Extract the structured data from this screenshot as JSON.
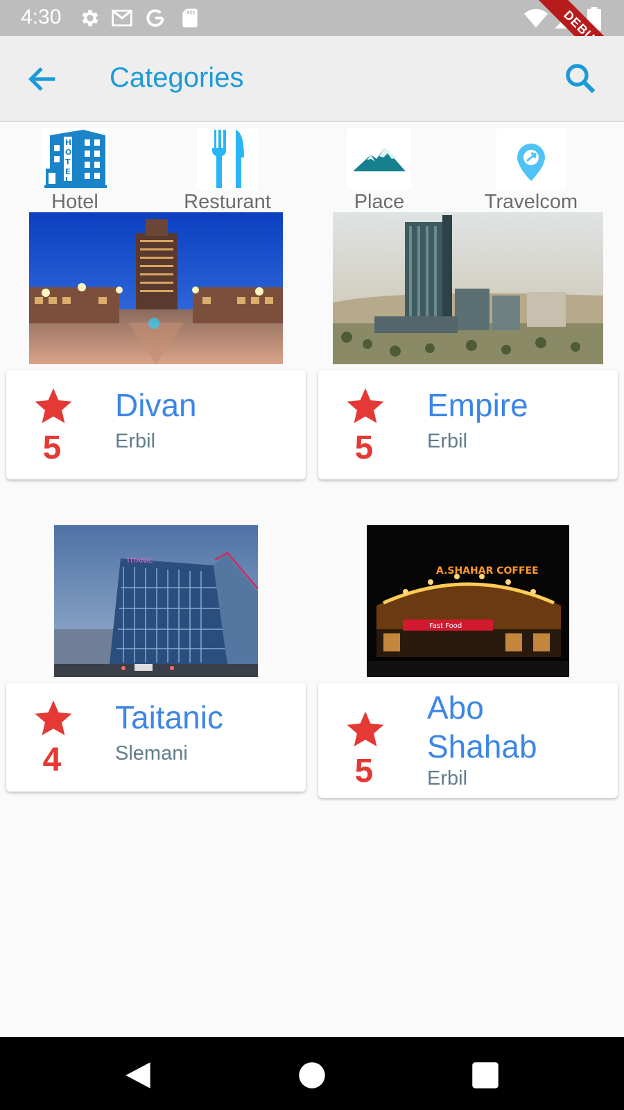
{
  "status_bar": {
    "time": "4:30",
    "icons": [
      "gear-icon",
      "gmail-icon",
      "google-icon",
      "sd-card-icon",
      "wifi-icon",
      "signal-icon",
      "battery-icon"
    ],
    "debug_label": "DEBUG"
  },
  "app_bar": {
    "title": "Categories",
    "back_icon": "arrow-back-icon",
    "search_icon": "search-icon",
    "accent_color": "#1a9bd7"
  },
  "categories": [
    {
      "label": "Hotel",
      "icon": "hotel-building-icon"
    },
    {
      "label": "Resturant",
      "icon": "fork-knife-icon"
    },
    {
      "label": "Place",
      "icon": "mountain-icon"
    },
    {
      "label": "Travelcom",
      "icon": "map-pin-plane-icon"
    }
  ],
  "places": [
    {
      "name": "Divan",
      "city": "Erbil",
      "rating": "5",
      "photo": "hotel-tower-night-photo"
    },
    {
      "name": "Empire",
      "city": "Erbil",
      "rating": "5",
      "photo": "glass-towers-desert-photo"
    },
    {
      "name": "Taitanic",
      "city": "Slemani",
      "rating": "4",
      "photo": "glass-hotel-dusk-photo"
    },
    {
      "name": "Abo Shahab",
      "city": "Erbil",
      "rating": "5",
      "photo": "shahar-coffee-night-photo"
    }
  ],
  "colors": {
    "star": "#e53935",
    "name": "#3d86e6",
    "city": "#607d8b"
  },
  "nav_bar": {
    "icons": [
      "back-triangle-icon",
      "home-circle-icon",
      "recents-square-icon"
    ]
  }
}
